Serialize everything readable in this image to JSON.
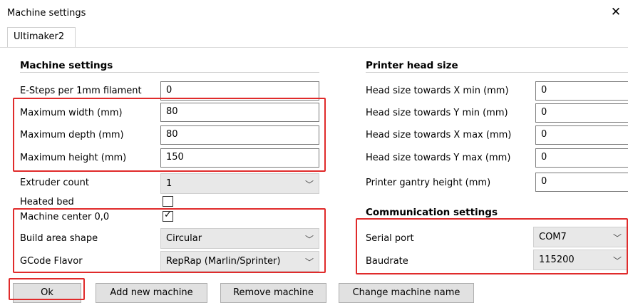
{
  "window": {
    "title": "Machine settings"
  },
  "tabs": [
    {
      "label": "Ultimaker2"
    }
  ],
  "machine": {
    "section_title": "Machine settings",
    "esteps": {
      "label": "E-Steps per 1mm filament",
      "value": "0"
    },
    "max_width": {
      "label": "Maximum width (mm)",
      "value": "80"
    },
    "max_depth": {
      "label": "Maximum depth (mm)",
      "value": "80"
    },
    "max_height": {
      "label": "Maximum height (mm)",
      "value": "150"
    },
    "extruder_count": {
      "label": "Extruder count",
      "value": "1"
    },
    "heated_bed": {
      "label": "Heated bed",
      "checked": false
    },
    "machine_center": {
      "label": "Machine center 0,0",
      "checked": true
    },
    "build_area_shape": {
      "label": "Build area shape",
      "value": "Circular"
    },
    "gcode_flavor": {
      "label": "GCode Flavor",
      "value": "RepRap (Marlin/Sprinter)"
    }
  },
  "printer_head": {
    "section_title": "Printer head size",
    "x_min": {
      "label": "Head size towards X min (mm)",
      "value": "0"
    },
    "y_min": {
      "label": "Head size towards Y min (mm)",
      "value": "0"
    },
    "x_max": {
      "label": "Head size towards X max (mm)",
      "value": "0"
    },
    "y_max": {
      "label": "Head size towards Y max (mm)",
      "value": "0"
    },
    "gantry_height": {
      "label": "Printer gantry height (mm)",
      "value": "0"
    }
  },
  "communication": {
    "section_title": "Communication settings",
    "serial_port": {
      "label": "Serial port",
      "value": "COM7"
    },
    "baudrate": {
      "label": "Baudrate",
      "value": "115200"
    }
  },
  "buttons": {
    "ok": "Ok",
    "add_machine": "Add new machine",
    "remove_machine": "Remove machine",
    "change_name": "Change machine name"
  },
  "icons": {
    "close": "close-icon",
    "dropdown": "chevron-down-icon",
    "check": "check-icon"
  },
  "colors": {
    "highlight": "#e02b2b",
    "select_bg": "#e8e8e8",
    "button_bg": "#e1e1e1"
  }
}
